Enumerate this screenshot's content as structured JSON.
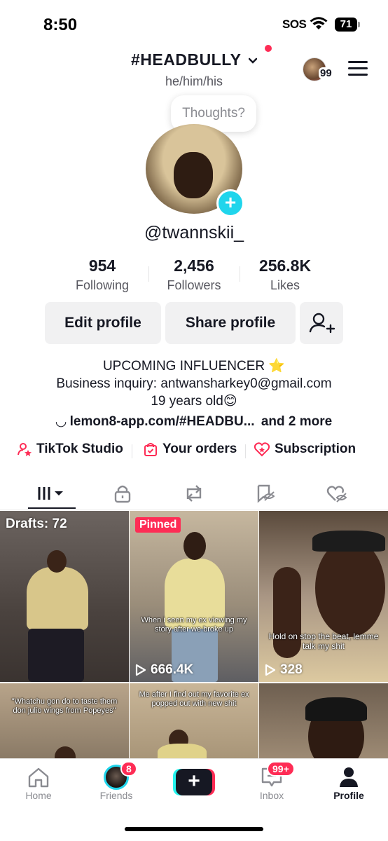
{
  "status_bar": {
    "time": "8:50",
    "sos": "SOS",
    "battery": "71"
  },
  "header": {
    "username": "#HEADBULLY",
    "pronouns": "he/him/his",
    "mini_avatar_count": "99"
  },
  "thought_bubble": "Thoughts?",
  "profile": {
    "handle": "@twannskii_"
  },
  "stats": [
    {
      "value": "954",
      "label": "Following"
    },
    {
      "value": "2,456",
      "label": "Followers"
    },
    {
      "value": "256.8K",
      "label": "Likes"
    }
  ],
  "buttons": {
    "edit": "Edit profile",
    "share": "Share profile"
  },
  "bio": {
    "line1": "UPCOMING INFLUENCER ⭐",
    "line2": "Business inquiry: antwansharkey0@gmail.com",
    "line3": "19 years old😊",
    "link": "lemon8-app.com/#HEADBU...",
    "link_more": "and 2 more"
  },
  "tools": {
    "studio": "TikTok Studio",
    "orders": "Your orders",
    "subscription": "Subscription"
  },
  "grid": {
    "drafts": "Drafts: 72",
    "pinned": "Pinned",
    "video2_caption": "When i seen my ex viewing my story after we broke up",
    "video2_views": "666.4K",
    "video3_caption": "Hold on stop the beat, lemme talk my shit",
    "video3_views": "328",
    "video4_caption": "\"Whatchu gon do to taste them don julio wings from Popeyes\"",
    "video5_caption": "Me after I find out my favorite ex popped out with new shit"
  },
  "bottom_nav": {
    "home": "Home",
    "friends": "Friends",
    "friends_badge": "8",
    "inbox": "Inbox",
    "inbox_badge": "99+",
    "profile": "Profile"
  },
  "colors": {
    "accent": "#fe2c55",
    "cyan": "#20d5ec",
    "text": "#161823",
    "muted": "#57575f"
  }
}
